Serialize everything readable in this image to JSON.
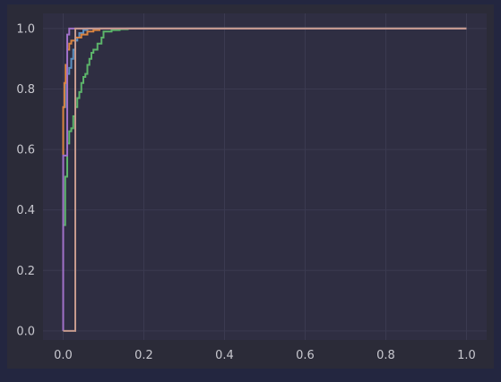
{
  "chart_data": {
    "type": "line",
    "title": "",
    "xlabel": "",
    "ylabel": "",
    "xlim": [
      -0.05,
      1.05
    ],
    "ylim": [
      -0.03,
      1.05
    ],
    "grid": true,
    "legend": "none",
    "x_ticks": [
      "0.0",
      "0.2",
      "0.4",
      "0.6",
      "0.8",
      "1.0"
    ],
    "y_ticks": [
      "0.0",
      "0.2",
      "0.4",
      "0.6",
      "0.8",
      "1.0"
    ],
    "series": [
      {
        "color": "#5b8fc0",
        "x": [
          0.0,
          0.0,
          0.005,
          0.005,
          0.01,
          0.01,
          0.015,
          0.015,
          0.02,
          0.02,
          0.025,
          0.025,
          0.03,
          0.03,
          0.035,
          0.035,
          0.04,
          0.04,
          0.05,
          0.05,
          0.06,
          0.06,
          1.0
        ],
        "y": [
          0.0,
          0.74,
          0.74,
          0.82,
          0.82,
          0.85,
          0.85,
          0.87,
          0.87,
          0.9,
          0.9,
          0.93,
          0.93,
          0.96,
          0.96,
          0.97,
          0.97,
          0.985,
          0.985,
          0.995,
          0.995,
          1.0,
          1.0
        ]
      },
      {
        "color": "#d98440",
        "x": [
          0.0,
          0.0,
          0.003,
          0.003,
          0.006,
          0.006,
          0.01,
          0.01,
          0.015,
          0.015,
          0.02,
          0.02,
          0.03,
          0.03,
          0.045,
          0.045,
          0.06,
          0.06,
          0.075,
          0.075,
          0.09,
          0.09,
          1.0
        ],
        "y": [
          0.0,
          0.74,
          0.74,
          0.82,
          0.82,
          0.88,
          0.88,
          0.93,
          0.93,
          0.95,
          0.95,
          0.96,
          0.96,
          0.97,
          0.97,
          0.98,
          0.98,
          0.99,
          0.99,
          0.995,
          0.995,
          1.0,
          1.0
        ]
      },
      {
        "color": "#5cb46a",
        "x": [
          0.0,
          0.0,
          0.005,
          0.005,
          0.01,
          0.01,
          0.015,
          0.015,
          0.02,
          0.02,
          0.025,
          0.025,
          0.03,
          0.03,
          0.035,
          0.035,
          0.04,
          0.04,
          0.045,
          0.045,
          0.05,
          0.05,
          0.055,
          0.055,
          0.06,
          0.06,
          0.065,
          0.065,
          0.07,
          0.07,
          0.075,
          0.075,
          0.085,
          0.085,
          0.095,
          0.095,
          0.1,
          0.1,
          0.12,
          0.12,
          0.14,
          0.14,
          0.16,
          0.16,
          1.0
        ],
        "y": [
          0.0,
          0.35,
          0.35,
          0.51,
          0.51,
          0.62,
          0.62,
          0.66,
          0.66,
          0.67,
          0.67,
          0.71,
          0.71,
          0.74,
          0.74,
          0.77,
          0.77,
          0.79,
          0.79,
          0.82,
          0.82,
          0.84,
          0.84,
          0.85,
          0.85,
          0.88,
          0.88,
          0.9,
          0.9,
          0.92,
          0.92,
          0.93,
          0.93,
          0.95,
          0.95,
          0.97,
          0.97,
          0.99,
          0.99,
          0.995,
          0.995,
          0.998,
          0.998,
          1.0,
          1.0
        ]
      },
      {
        "color": "#a070c8",
        "x": [
          0.0,
          0.0,
          0.01,
          0.01,
          0.015,
          0.015,
          1.0
        ],
        "y": [
          0.0,
          0.58,
          0.58,
          0.98,
          0.98,
          1.0,
          1.0
        ]
      },
      {
        "color": "#c69a8e",
        "x": [
          0.0,
          0.0,
          0.03,
          0.03,
          1.0
        ],
        "y": [
          0.0,
          0.0,
          0.0,
          1.0,
          1.0
        ]
      }
    ]
  }
}
